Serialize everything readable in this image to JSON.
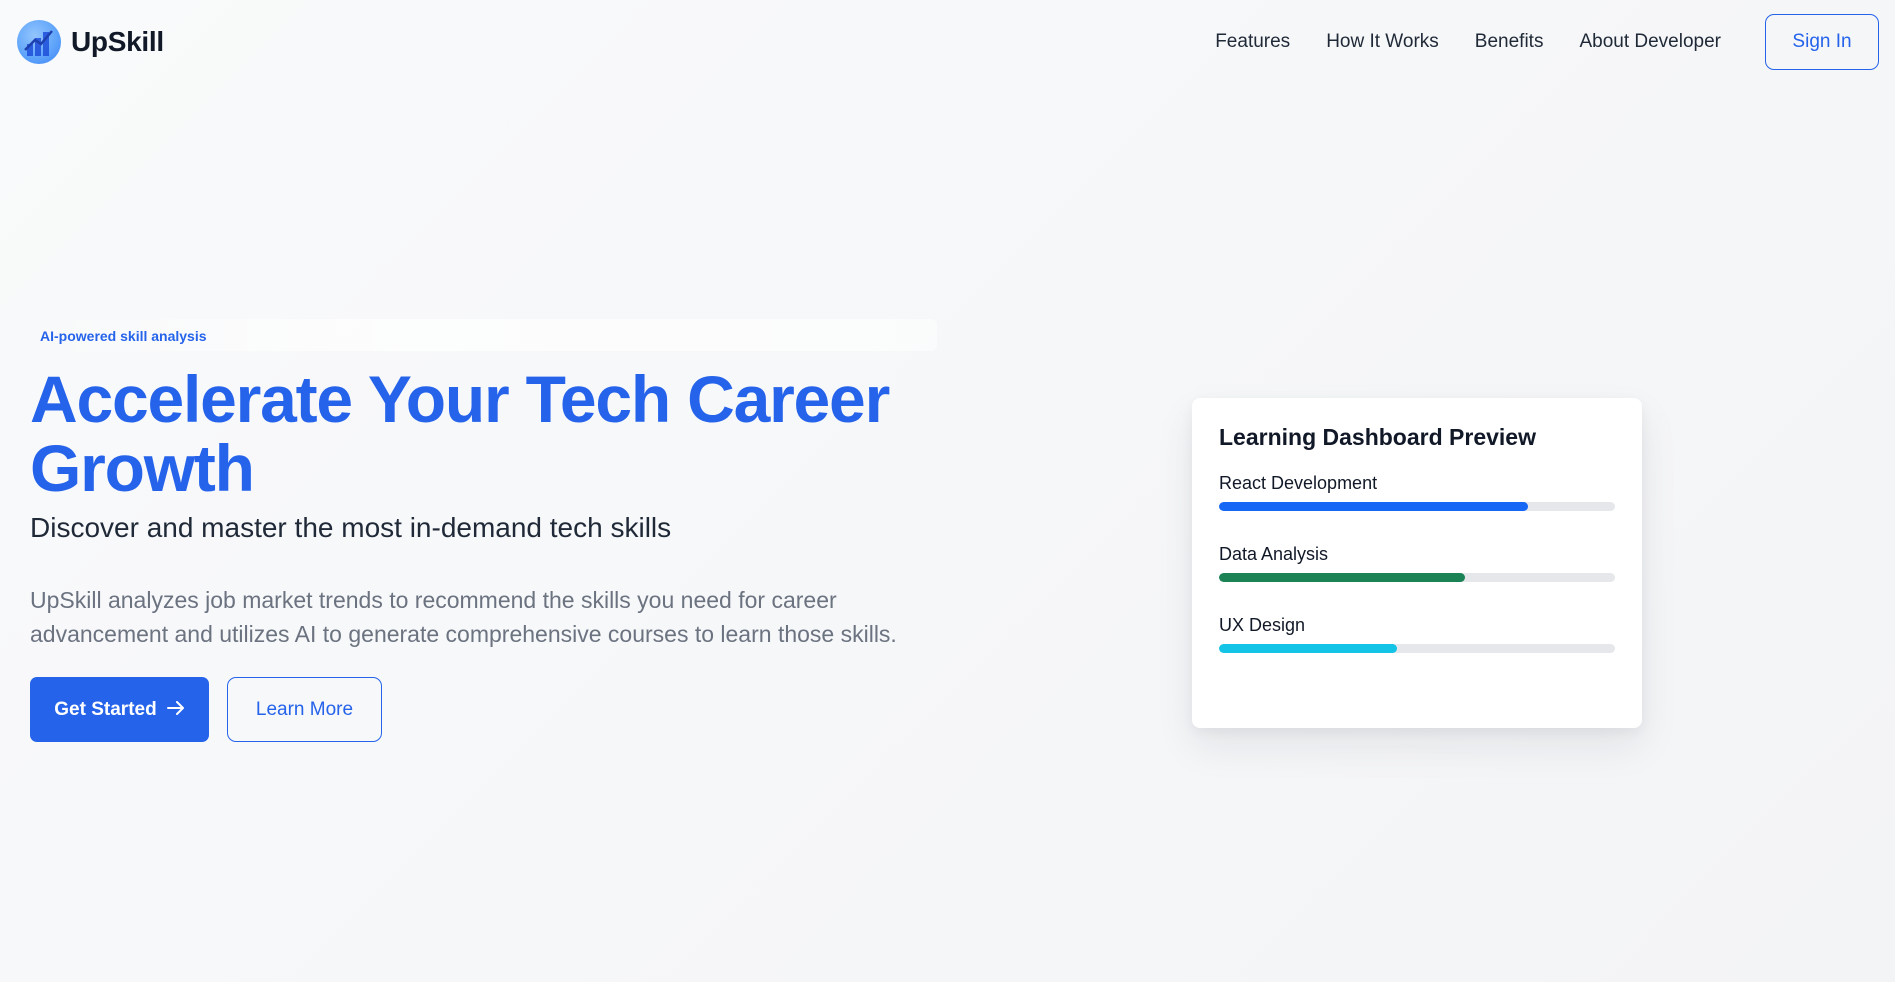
{
  "brand": {
    "name": "UpSkill",
    "logo_icon": "chart-growth-icon"
  },
  "nav": {
    "links": [
      "Features",
      "How It Works",
      "Benefits",
      "About Developer"
    ],
    "signin_label": "Sign In"
  },
  "hero": {
    "badge": "AI-powered skill analysis",
    "headline": "Accelerate Your Tech Career Growth",
    "subheadline": "Discover and master the most in-demand tech skills",
    "description": "UpSkill analyzes job market trends to recommend the skills you need for career advancement and utilizes AI to generate comprehensive courses to learn those skills.",
    "primary_cta": "Get Started",
    "primary_cta_icon": "arrow-right-icon",
    "secondary_cta": "Learn More"
  },
  "dashboard": {
    "title": "Learning Dashboard Preview",
    "skills": [
      {
        "label": "React Development",
        "progress": 0.78,
        "color": "#1667f5"
      },
      {
        "label": "Data Analysis",
        "progress": 0.62,
        "color": "#1b8256"
      },
      {
        "label": "UX Design",
        "progress": 0.45,
        "color": "#13c4e6"
      }
    ]
  },
  "colors": {
    "accent": "#2563eb",
    "text": "#111827",
    "muted": "#6b7280"
  }
}
